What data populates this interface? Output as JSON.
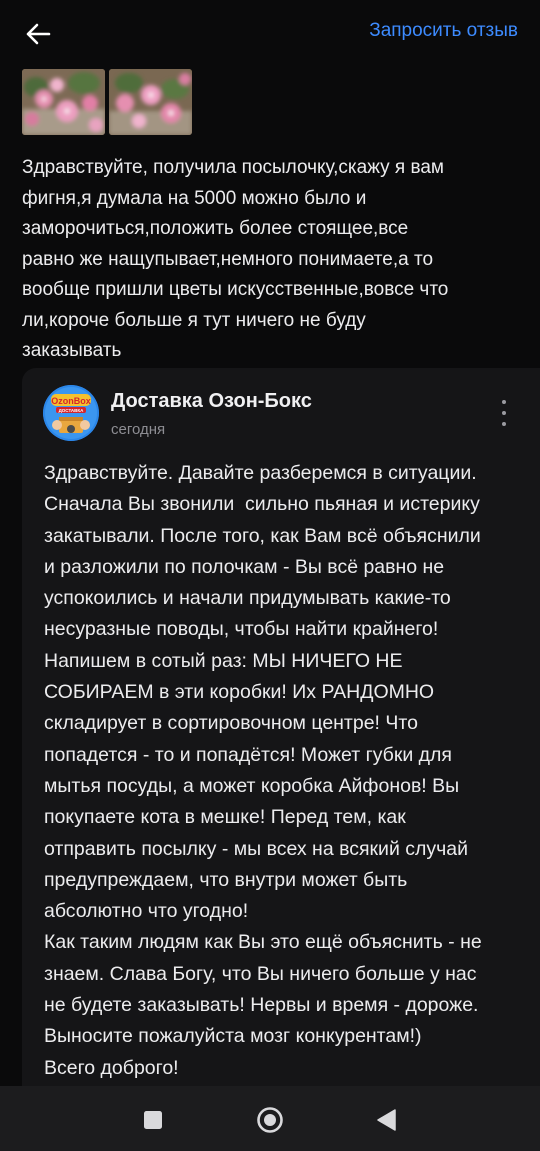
{
  "header": {
    "back_icon": "arrow-left-icon",
    "request_review_label": "Запросить отзыв"
  },
  "review": {
    "photos": [
      {
        "description_icon": "flower-photo"
      },
      {
        "description_icon": "flower-photo"
      }
    ],
    "text": "Здравствуйте, получила посылочку,скажу я вам\nфигня,я думала на 5000 можно было и\nзаморочиться,положить более стоящее,все\nравно же нащупывает,немного понимаете,а то\nвообще пришли цветы искусственные,вовсе что\nли,короче больше я тут ничего не буду\nзаказывать"
  },
  "reply": {
    "seller_name": "Доставка Озон-Бокс",
    "date": "сегодня",
    "avatar_brand_text": "OzonBox",
    "avatar_brand_subtext": "ДОСТАВКА",
    "text": "Здравствуйте. Давайте разберемся в ситуации.\nСначала Вы звонили  сильно пьяная и истерику\nзакатывали. После того, как Вам всё объяснили\nи разложили по полочкам - Вы всё равно не\nуспокоились и начали придумывать какие-то\nнесуразные поводы, чтобы найти крайнего!\nНапишем в сотый раз: МЫ НИЧЕГО НЕ\nСОБИРАЕМ в эти коробки! Их РАНДОМНО\nскладирует в сортировочном центре! Что\nпопадется - то и попадётся! Может губки для\nмытья посуды, а может коробка Айфонов! Вы\nпокупаете кота в мешке! Перед тем, как\nотправить посылку - мы всех на всякий случай\nпредупреждаем, что внутри может быть\nабсолютно что угодно!\nКак таким людям как Вы это ещё объяснить - не\nзнаем. Слава Богу, что Вы ничего больше у нас\nне будете заказывать! Нервы и время - дороже.\nВыносите пожалуйста мозг конкурентам!)\nВсего доброго!"
  },
  "navbar": {
    "items": [
      "square-stop-icon",
      "circle-home-icon",
      "triangle-back-icon"
    ]
  },
  "colors": {
    "background": "#0a0a0b",
    "accent": "#3d8bff",
    "card": "#151517",
    "navbar": "#1c1c1e"
  }
}
